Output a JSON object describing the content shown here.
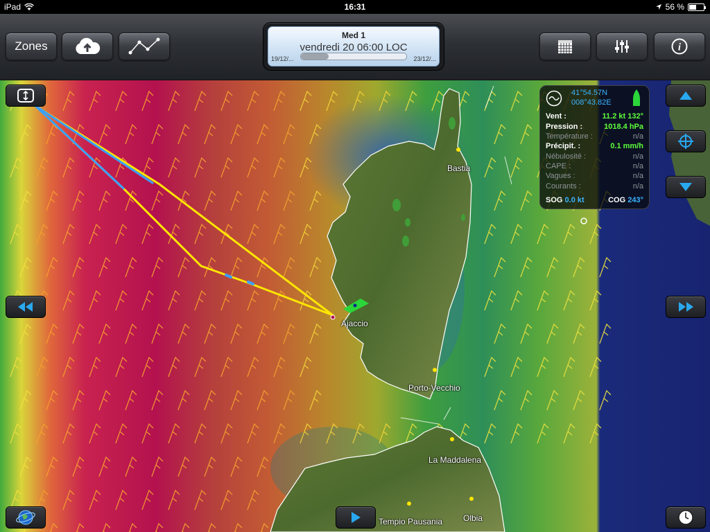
{
  "status_bar": {
    "device": "iPad",
    "time": "16:31",
    "battery": "56 %",
    "battery_fraction": 0.56
  },
  "toolbar": {
    "zones_label": "Zones",
    "upload_icon": "cloud-upload-icon",
    "route_icon": "route-polyline-icon",
    "calendar_icon": "calendar-icon",
    "settings_icon": "sliders-icon",
    "info_icon": "info-icon"
  },
  "time_panel": {
    "title": "Med 1",
    "date": "vendredi 20 06:00 LOC",
    "start": "19/12/...",
    "end": "23/12/...",
    "progress": 0.26
  },
  "map": {
    "places": [
      {
        "name": "Bastia"
      },
      {
        "name": "Ajaccio"
      },
      {
        "name": "Porto-Vecchio"
      },
      {
        "name": "La Maddalena"
      },
      {
        "name": "Tempio Pausania"
      },
      {
        "name": "Olbia"
      }
    ],
    "colors": {
      "route": "#ffe600",
      "route_alt": "#3aa0ff",
      "sea_cold": "#1a237e",
      "wind_strong": "#b3124e"
    }
  },
  "info_panel": {
    "lat": "41°54.57N",
    "lon": "008°43.82E",
    "rows": [
      {
        "label": "Vent :",
        "value": "11.2 kt 132°"
      },
      {
        "label": "Pression :",
        "value": "1018.4 hPa"
      },
      {
        "label": "Température :",
        "value": "n/a"
      },
      {
        "label": "Précipit. :",
        "value": "0.1 mm/h"
      },
      {
        "label": "Nébulosité :",
        "value": "n/a"
      },
      {
        "label": "CAPE :",
        "value": "n/a"
      },
      {
        "label": "Vagues :",
        "value": "n/a"
      },
      {
        "label": "Courants :",
        "value": "n/a"
      }
    ],
    "sog_label": "SOG",
    "sog_value": "0.0 kt",
    "cog_label": "COG",
    "cog_value": "243°"
  },
  "overlay": {
    "up_icon": "triangle-up-icon",
    "target_icon": "crosshair-icon",
    "down_icon": "triangle-down-icon",
    "rewind_icon": "rewind-icon",
    "forward_icon": "fast-forward-icon",
    "play_icon": "play-icon",
    "globe_icon": "globe-icon",
    "clock_icon": "clock-icon",
    "expand_icon": "expand-vertical-icon"
  }
}
